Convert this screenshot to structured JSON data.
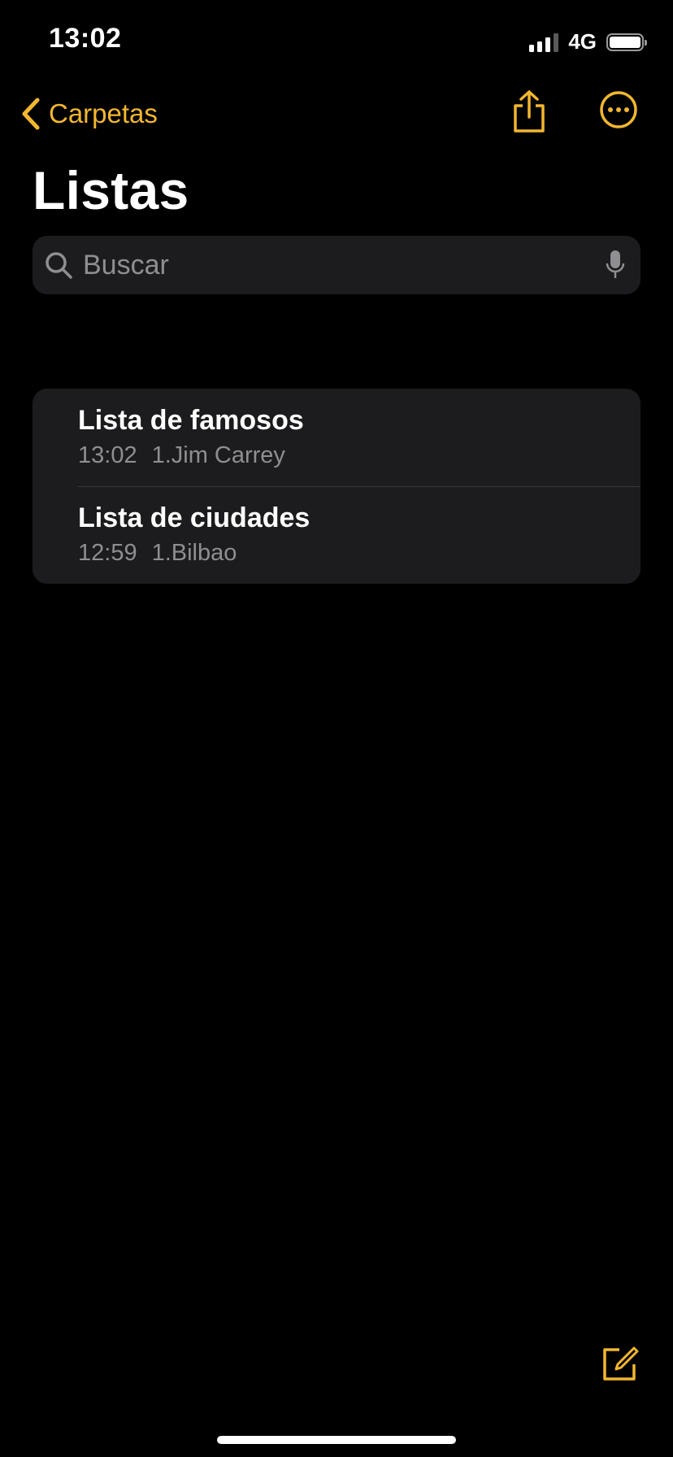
{
  "status_bar": {
    "time": "13:02",
    "network": "4G"
  },
  "nav": {
    "back_label": "Carpetas",
    "share_icon": "share-icon",
    "more_icon": "ellipsis-circle-icon"
  },
  "title": "Listas",
  "search": {
    "placeholder": "Buscar",
    "value": ""
  },
  "notes": [
    {
      "title": "Lista de famosos",
      "time": "13:02",
      "preview": "1.Jim Carrey"
    },
    {
      "title": "Lista de ciudades",
      "time": "12:59",
      "preview": "1.Bilbao"
    }
  ],
  "colors": {
    "accent": "#f2b630",
    "background": "#000000",
    "cell": "#1c1c1e",
    "secondary_text": "#8e8e93"
  }
}
